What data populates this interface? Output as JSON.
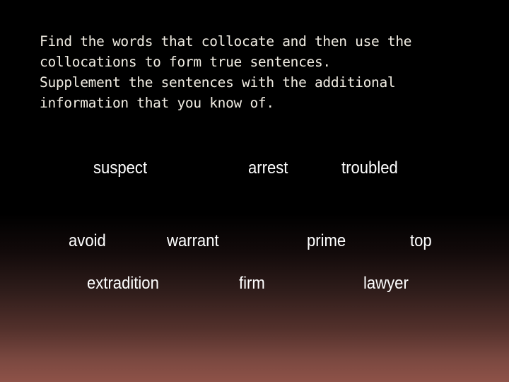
{
  "slide": {
    "instructions": [
      "Find the words that collocate and then use the",
      "collocations to form true sentences.",
      "Supplement the sentences with the additional",
      "information that you know of."
    ],
    "words": {
      "suspect": "suspect",
      "arrest": "arrest",
      "troubled": "troubled",
      "avoid": "avoid",
      "warrant": "warrant",
      "prime": "prime",
      "top": "top",
      "extradition": "extradition",
      "firm": "firm",
      "lawyer": "lawyer"
    },
    "colors": {
      "text": "#ffffff",
      "instruction_text": "#f2eee4",
      "background_top": "#000000",
      "background_bottom": "#8e5248"
    }
  }
}
